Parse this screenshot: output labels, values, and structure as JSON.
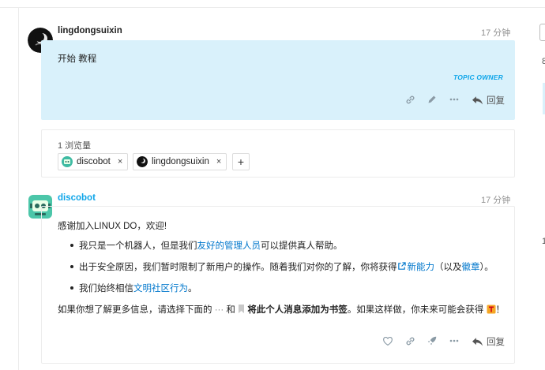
{
  "post1": {
    "username": "lingdongsuixin",
    "time": "17 分钟",
    "content": "开始 教程",
    "owner_badge": "TOPIC OWNER",
    "reply_label": "回复"
  },
  "views": {
    "count_label": "1 浏览量",
    "chips": [
      {
        "label": "discobot",
        "remove": "×"
      },
      {
        "label": "lingdongsuixin",
        "remove": "×"
      }
    ],
    "add": "+"
  },
  "post2": {
    "username": "discobot",
    "time": "17 分钟",
    "greeting": "感谢加入LINUX DO，欢迎!",
    "bullet1": {
      "pre": "我只是一个机器人，但是我们",
      "link": "友好的管理人员",
      "post": "可以提供真人帮助。"
    },
    "bullet2": {
      "pre": "出于安全原因，我们暂时限制了新用户的操作。随着我们对你的了解，你将获得",
      "link1": "新能力",
      "mid": "（以及",
      "link2": "徽章",
      "post": "）。"
    },
    "bullet3": {
      "pre": "我们始终相信",
      "link": "文明社区行为",
      "post": "。"
    },
    "footer": {
      "pre": "如果你想了解更多信息，请选择下面的",
      "dots": "···",
      "mid": "和",
      "bold": "将此个人消息添加为书签",
      "post": "。如果这样做，你未来可能会获得",
      "end": "！"
    },
    "reply_label": "回复"
  },
  "side": {
    "frag_top": "8",
    "frag_mid": "1"
  },
  "colors": {
    "accent": "#0ea5e9",
    "owner_bg": "#d9f1fb",
    "link": "#0077cc"
  }
}
